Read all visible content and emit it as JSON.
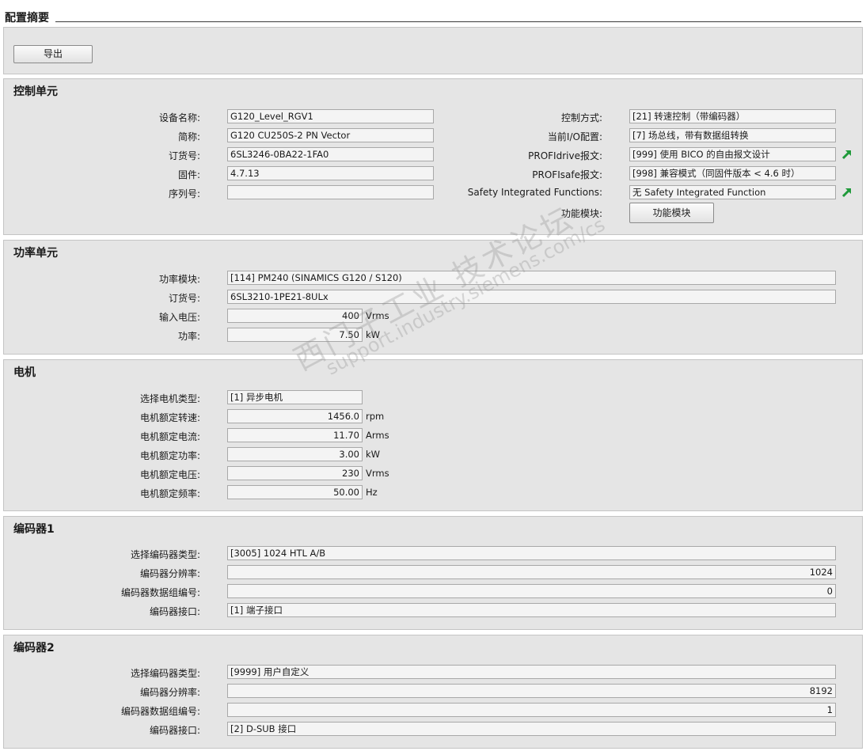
{
  "page": {
    "title": "配置摘要"
  },
  "toolbar": {
    "export_label": "导出"
  },
  "control_unit": {
    "title": "控制单元",
    "device_name_label": "设备名称:",
    "device_name": "G120_Level_RGV1",
    "short_name_label": "简称:",
    "short_name": "G120 CU250S-2 PN Vector",
    "order_no_label": "订货号:",
    "order_no": "6SL3246-0BA22-1FA0",
    "firmware_label": "固件:",
    "firmware": "4.7.13",
    "serial_label": "序列号:",
    "serial": "",
    "control_mode_label": "控制方式:",
    "control_mode": "[21] 转速控制（带编码器）",
    "io_config_label": "当前I/O配置:",
    "io_config": "[7] 场总线，带有数据组转换",
    "profidrive_label": "PROFIdrive报文:",
    "profidrive": "[999] 使用 BICO 的自由报文设计",
    "profisafe_label": "PROFIsafe报文:",
    "profisafe": "[998] 兼容模式（同固件版本 < 4.6 时）",
    "safety_label": "Safety Integrated Functions:",
    "safety": "无 Safety Integrated Function",
    "function_module_label": "功能模块:",
    "function_module_button": "功能模块"
  },
  "power_unit": {
    "title": "功率单元",
    "module_label": "功率模块:",
    "module": "[114] PM240 (SINAMICS G120 / S120)",
    "order_no_label": "订货号:",
    "order_no": "6SL3210-1PE21-8ULx",
    "input_voltage_label": "输入电压:",
    "input_voltage": "400",
    "input_voltage_unit": "Vrms",
    "power_label": "功率:",
    "power": "7.50",
    "power_unit": "kW"
  },
  "motor": {
    "title": "电机",
    "type_label": "选择电机类型:",
    "type": "[1] 异步电机",
    "speed_label": "电机额定转速:",
    "speed": "1456.0",
    "speed_unit": "rpm",
    "current_label": "电机额定电流:",
    "current": "11.70",
    "current_unit": "Arms",
    "power_label": "电机额定功率:",
    "power": "3.00",
    "power_unit": "kW",
    "voltage_label": "电机额定电压:",
    "voltage": "230",
    "voltage_unit": "Vrms",
    "frequency_label": "电机额定频率:",
    "frequency": "50.00",
    "frequency_unit": "Hz"
  },
  "encoder1": {
    "title": "编码器1",
    "type_label": "选择编码器类型:",
    "type": "[3005] 1024 HTL A/B",
    "resolution_label": "编码器分辨率:",
    "resolution": "1024",
    "dataset_label": "编码器数据组编号:",
    "dataset": "0",
    "interface_label": "编码器接口:",
    "interface": "[1] 端子接口"
  },
  "encoder2": {
    "title": "编码器2",
    "type_label": "选择编码器类型:",
    "type": "[9999] 用户自定义",
    "resolution_label": "编码器分辨率:",
    "resolution": "8192",
    "dataset_label": "编码器数据组编号:",
    "dataset": "1",
    "interface_label": "编码器接口:",
    "interface": "[2] D-SUB 接口"
  },
  "watermark": {
    "line1": "西门子工业 技术论坛",
    "line2": "support.industry.siemens.com/cs"
  },
  "colors": {
    "panel_bg": "#e5e5e5",
    "field_bg": "#f4f4f4",
    "arrow_green": "#1f9a3a"
  },
  "icons": {
    "profidrive_link": "green-arrow-icon",
    "safety_link": "green-arrow-icon"
  }
}
